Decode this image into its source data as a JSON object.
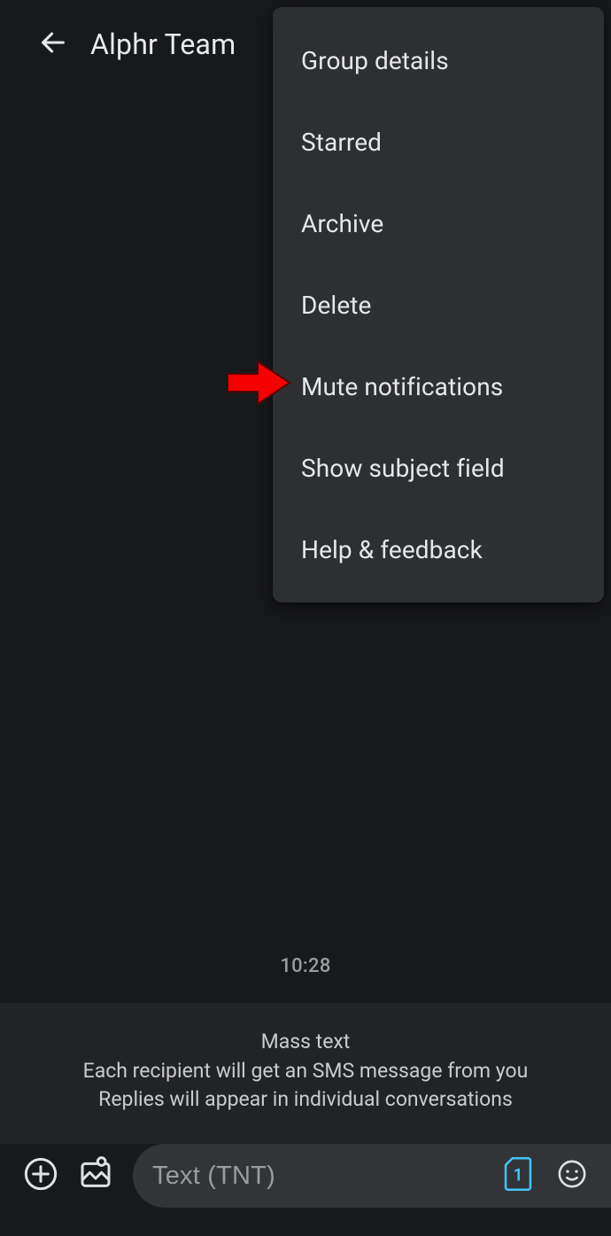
{
  "header": {
    "title": "Alphr Team"
  },
  "menu": {
    "items": [
      {
        "label": "Group details"
      },
      {
        "label": "Starred"
      },
      {
        "label": "Archive"
      },
      {
        "label": "Delete"
      },
      {
        "label": "Mute notifications"
      },
      {
        "label": "Show subject field"
      },
      {
        "label": "Help & feedback"
      }
    ]
  },
  "timestamp": "10:28",
  "banner": {
    "title": "Mass text",
    "line1": "Each recipient will get an SMS message from you",
    "line2": "Replies will appear in individual conversations"
  },
  "composer": {
    "placeholder": "Text (TNT)",
    "sim_label": "1"
  }
}
